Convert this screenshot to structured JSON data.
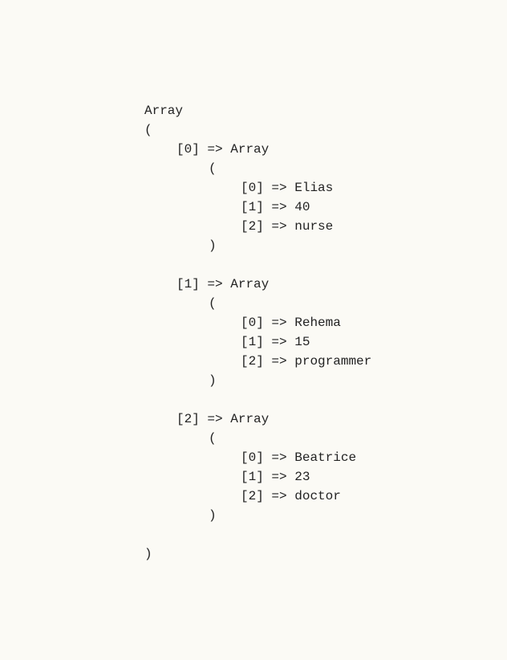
{
  "header": "Array",
  "open_paren": "(",
  "close_paren": ")",
  "arrow": "=>",
  "inner_label": "Array",
  "entries": [
    {
      "index": "[0]",
      "items": [
        {
          "key": "[0]",
          "value": "Elias"
        },
        {
          "key": "[1]",
          "value": "40"
        },
        {
          "key": "[2]",
          "value": "nurse"
        }
      ]
    },
    {
      "index": "[1]",
      "items": [
        {
          "key": "[0]",
          "value": "Rehema"
        },
        {
          "key": "[1]",
          "value": "15"
        },
        {
          "key": "[2]",
          "value": "programmer"
        }
      ]
    },
    {
      "index": "[2]",
      "items": [
        {
          "key": "[0]",
          "value": "Beatrice"
        },
        {
          "key": "[1]",
          "value": "23"
        },
        {
          "key": "[2]",
          "value": "doctor"
        }
      ]
    }
  ]
}
